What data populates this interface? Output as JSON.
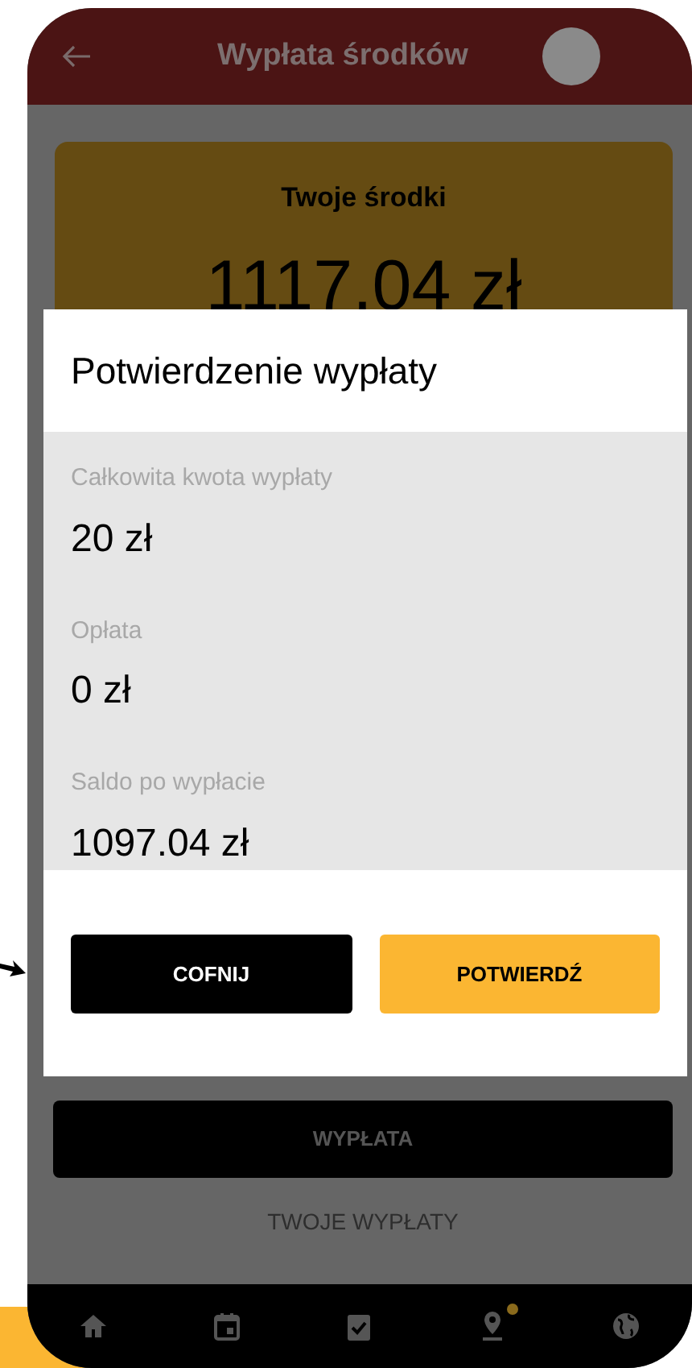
{
  "header": {
    "title": "Wypłata środków"
  },
  "balance_card": {
    "label": "Twoje środki",
    "amount": "1117.04 zł"
  },
  "dialog": {
    "title": "Potwierdzenie wypłaty",
    "rows": [
      {
        "label": "Całkowita kwota wypłaty",
        "value": "20 zł"
      },
      {
        "label": "Opłata",
        "value": "0 zł"
      },
      {
        "label": "Saldo po wypłacie",
        "value": "1097.04 zł"
      }
    ],
    "buttons": [
      {
        "label": "COFNIJ",
        "kind": "secondary"
      },
      {
        "label": "POTWIERDŹ",
        "kind": "primary"
      }
    ]
  },
  "withdraw_button": {
    "label": "WYPŁATA"
  },
  "history_link": {
    "label": "TWOJE WYPŁATY"
  },
  "bottom_nav": [
    {
      "kind": "home",
      "badge": false
    },
    {
      "kind": "calendar",
      "badge": false
    },
    {
      "kind": "clipboard",
      "badge": false
    },
    {
      "kind": "pin",
      "badge": true
    },
    {
      "kind": "globe",
      "badge": false
    }
  ]
}
